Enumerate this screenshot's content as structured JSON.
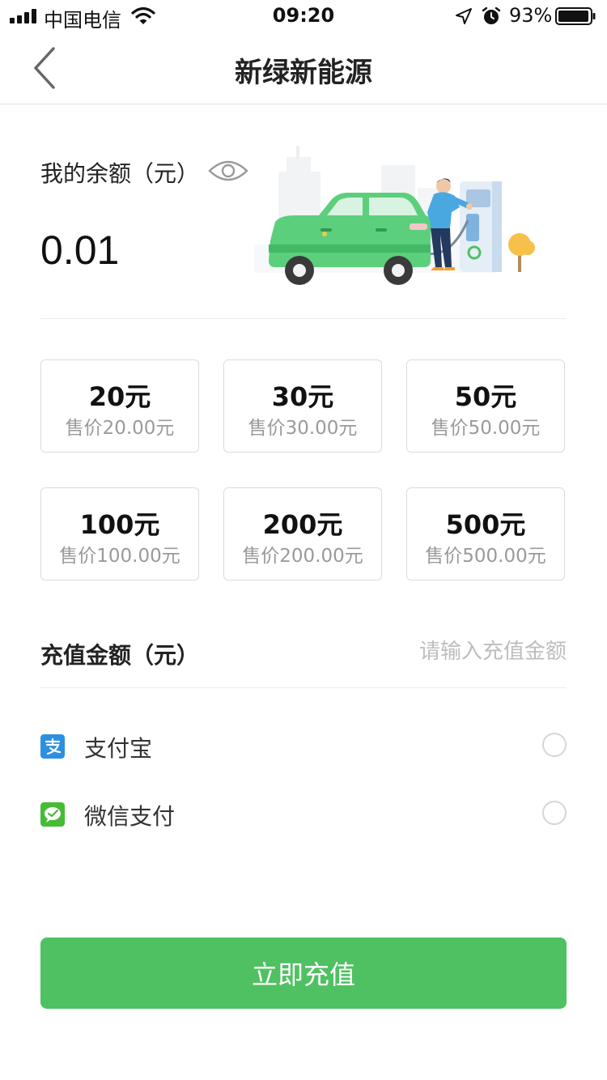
{
  "status_bar": {
    "carrier": "中国电信",
    "time": "09:20",
    "battery_pct": "93%",
    "icons": [
      "signal-icon",
      "wifi-icon",
      "location-arrow-icon",
      "alarm-icon",
      "battery-icon"
    ]
  },
  "nav": {
    "title": "新绿新能源",
    "back_icon": "chevron-left-icon"
  },
  "balance": {
    "label": "我的余额（元）",
    "value": "0.01",
    "eye_icon": "eye-icon"
  },
  "amounts": [
    {
      "amount": "20元",
      "price": "售价20.00元"
    },
    {
      "amount": "30元",
      "price": "售价30.00元"
    },
    {
      "amount": "50元",
      "price": "售价50.00元"
    },
    {
      "amount": "100元",
      "price": "售价100.00元"
    },
    {
      "amount": "200元",
      "price": "售价200.00元"
    },
    {
      "amount": "500元",
      "price": "售价500.00元"
    }
  ],
  "recharge": {
    "label": "充值金额（元）",
    "placeholder": "请输入充值金额"
  },
  "payment_methods": [
    {
      "label": "支付宝",
      "icon": "alipay-icon",
      "selected": false
    },
    {
      "label": "微信支付",
      "icon": "wechat-pay-icon",
      "selected": false
    }
  ],
  "submit_label": "立即充值",
  "colors": {
    "accent_green": "#4fc162",
    "alipay_blue": "#2d8fe0",
    "wechat_green": "#46bb36",
    "muted_text": "#9a9a9a"
  }
}
